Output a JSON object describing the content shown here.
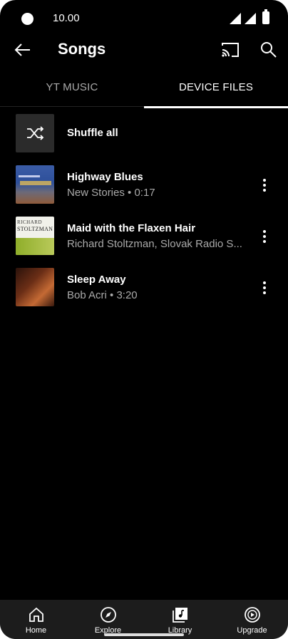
{
  "status_bar": {
    "time": "10.00"
  },
  "app_bar": {
    "title": "Songs"
  },
  "tabs": [
    {
      "label": "YT MUSIC",
      "selected": false
    },
    {
      "label": "DEVICE FILES",
      "selected": true
    }
  ],
  "shuffle": {
    "label": "Shuffle all",
    "icon": "shuffle-icon"
  },
  "songs": [
    {
      "title": "Highway Blues",
      "subtitle": "New Stories • 0:17"
    },
    {
      "title": "Maid with the Flaxen Hair",
      "subtitle": "Richard Stoltzman, Slovak Radio S..."
    },
    {
      "title": "Sleep Away",
      "subtitle": "Bob Acri • 3:20"
    }
  ],
  "album_art": {
    "maid_text_1": "RICHARD",
    "maid_text_2": "STOLTZMAN"
  },
  "bottom_nav": [
    {
      "label": "Home",
      "icon": "home-icon"
    },
    {
      "label": "Explore",
      "icon": "compass-icon"
    },
    {
      "label": "Library",
      "icon": "library-icon"
    },
    {
      "label": "Upgrade",
      "icon": "upgrade-icon"
    }
  ],
  "colors": {
    "background": "#000000",
    "secondary_text": "#aaaaaa",
    "bottom_bar": "#1c1c1c"
  }
}
